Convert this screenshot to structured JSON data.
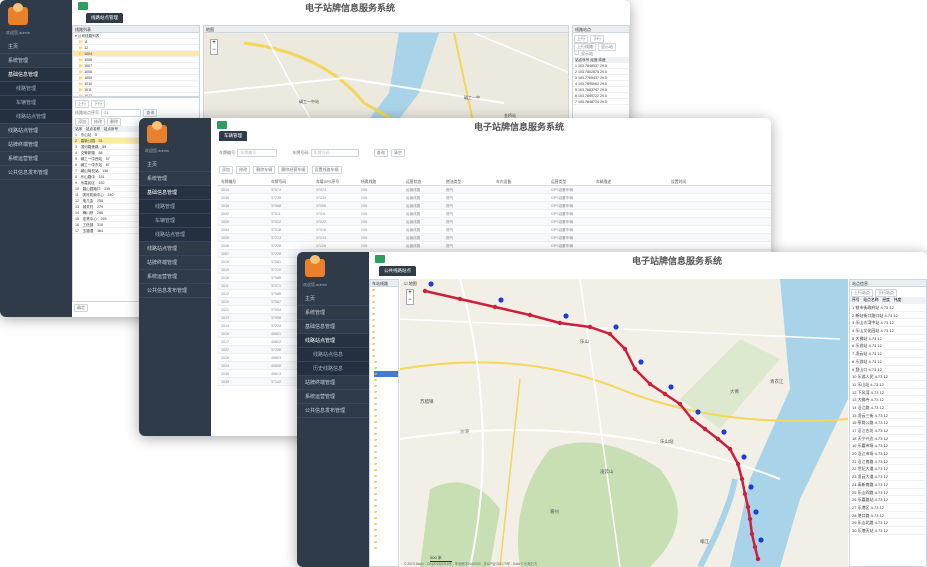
{
  "app_title": "电子站牌信息服务系统",
  "sidebar": {
    "user": "欢迎您,admin",
    "items": [
      "主页",
      "系统管理",
      "基础信息管理",
      "线路管理",
      "车辆管理",
      "线路站点管理",
      "站牌终端管理",
      "系统运营管理",
      "公共信息发布管理"
    ],
    "sub_items": [
      "线路管理",
      "车辆管理",
      "线路站点管理"
    ],
    "w3_sub_items": [
      "线路站点信息",
      "历史线路信息"
    ]
  },
  "window1": {
    "tab": "线路站点管理",
    "left_panel_title": "线路列表",
    "tree_root": "公司线路列表",
    "tree_items": [
      "11",
      "12",
      "1004",
      "1006",
      "1007",
      "1008",
      "1009",
      "1010",
      "1011",
      "1012"
    ],
    "dir_tabs": [
      "上行",
      "下行"
    ],
    "query_label": "线路站点序号:",
    "query_value": "21",
    "query_btn": "查询",
    "toolbar": [
      "添加",
      "修改",
      "删除"
    ],
    "cols": [
      "站序",
      "站点名称",
      "站点序号"
    ],
    "stops": [
      [
        "1",
        "东山站",
        "8"
      ],
      [
        "2",
        "高新公园",
        "31"
      ],
      [
        "3",
        "滨河路莲路",
        "59"
      ],
      [
        "4",
        "交警新路",
        "58"
      ],
      [
        "5",
        "碱工一中西站",
        "57"
      ],
      [
        "6",
        "碱工一中东站",
        "87"
      ],
      [
        "7",
        "碱山驾校站",
        "136"
      ],
      [
        "8",
        "乐山路中",
        "151"
      ],
      [
        "9",
        "乐嘉民区",
        "152"
      ],
      [
        "10",
        "碧山园路口",
        "235"
      ],
      [
        "11",
        "滨河苑南中心",
        "240"
      ],
      [
        "12",
        "电几会",
        "255"
      ],
      [
        "13",
        "城关村",
        "279"
      ],
      [
        "14",
        "梅川桥",
        "266"
      ],
      [
        "15",
        "定慧中心",
        "293"
      ],
      [
        "16",
        "工信部",
        "318"
      ],
      [
        "17",
        "玉福谭",
        "364"
      ]
    ],
    "map_title": "地图",
    "map_places": [
      "碱工一中站",
      "碱工一中",
      "金桥站"
    ],
    "right_title": "线路站点",
    "right_tabs": [
      "上行",
      "下行"
    ],
    "right_select": "上行线路",
    "right_btn": "显示站",
    "right_check": "显示站",
    "right_cols": [
      "站点序号",
      "经度",
      "纬度"
    ],
    "right_rows": [
      [
        "1",
        "103.7848537",
        "29.5"
      ],
      [
        "2",
        "103.7802875",
        "29.5"
      ],
      [
        "3",
        "103.7765437",
        "29.5"
      ],
      [
        "4",
        "103.7895062",
        "29.5"
      ],
      [
        "5",
        "103.7683747",
        "29.5"
      ],
      [
        "6",
        "103.7649722",
        "29.5"
      ],
      [
        "7",
        "103.7648724",
        "29.5"
      ]
    ],
    "footer": "确定"
  },
  "window2": {
    "tab": "车辆管理",
    "filter_label1": "车牌编号:",
    "filter_label2": "车牌号码:",
    "filter_ph1": "车牌编号",
    "filter_ph2": "车牌号码",
    "search_btn": "查询",
    "clear_btn": "清空",
    "toolbar": [
      "添加",
      "修改",
      "删除车辆",
      "删除经营车辆",
      "设置线路车辆"
    ],
    "cols": [
      "车牌编号",
      "车牌号码",
      "车载GPS序号",
      "所属线路",
      "运营状态",
      "燃油类型",
      "车内设备",
      "运营类型",
      "车辆描述",
      "设置时间"
    ],
    "rows": [
      [
        "3014",
        "37074",
        "37074",
        "205",
        "运营线路",
        "燃气",
        "GPS设置车辆"
      ],
      [
        "3040",
        "37239",
        "37239",
        "205",
        "运营线路",
        "燃气",
        "GPS设置车辆"
      ],
      [
        "3038",
        "37068",
        "37068",
        "205",
        "运营线路",
        "燃气",
        "GPS设置车辆"
      ],
      [
        "3092",
        "37011",
        "37011",
        "205",
        "运营线路",
        "燃气",
        "GPS设置车辆"
      ],
      [
        "3009",
        "37022",
        "37022",
        "205",
        "运营线路",
        "燃气",
        "GPS设置车辆"
      ],
      [
        "3054",
        "37018",
        "37018",
        "205",
        "运营线路",
        "燃气",
        "GPS设置车辆"
      ],
      [
        "3005",
        "37213",
        "37213",
        "205",
        "运营线路",
        "燃气",
        "GPS设置车辆"
      ],
      [
        "3058",
        "37228",
        "37228",
        "205",
        "运营线路",
        "燃气",
        "GPS设置车辆"
      ],
      [
        "3067",
        "37228",
        "37228",
        "205",
        "运营线路",
        "燃气",
        "GPS设置车辆"
      ],
      [
        "3018",
        "37081",
        "37081",
        "",
        "",
        "",
        ""
      ],
      [
        "3019",
        "37210",
        "37210",
        "",
        "",
        "",
        ""
      ],
      [
        "3016",
        "37086",
        "37086",
        "",
        "",
        "",
        ""
      ],
      [
        "3011",
        "37071",
        "37071",
        "",
        "",
        "",
        ""
      ],
      [
        "3012",
        "37086",
        "37086",
        "",
        "",
        "",
        ""
      ],
      [
        "3020",
        "37067",
        "37067",
        "",
        "",
        "",
        ""
      ],
      [
        "3021",
        "37054",
        "37054",
        "",
        "",
        "",
        ""
      ],
      [
        "3013",
        "37098",
        "37098",
        "",
        "",
        "",
        ""
      ],
      [
        "3014",
        "37224",
        "37224",
        "",
        "",
        "",
        ""
      ],
      [
        "3016",
        "49801",
        "49801",
        "",
        "",
        "",
        ""
      ],
      [
        "3017",
        "49802",
        "49802",
        "",
        "",
        "",
        ""
      ],
      [
        "3027",
        "37206",
        "37206",
        "",
        "",
        "",
        ""
      ],
      [
        "3028",
        "49803",
        "49803",
        "",
        "",
        "",
        ""
      ],
      [
        "3024",
        "49806",
        "49806",
        "",
        "",
        "",
        ""
      ],
      [
        "3030",
        "49813",
        "49813",
        "",
        "",
        "",
        ""
      ],
      [
        "3035",
        "37142",
        "37142",
        "",
        "",
        "",
        ""
      ]
    ]
  },
  "window3": {
    "tab": "公共线路站点",
    "left_title": "车站线路",
    "map_check": "地图",
    "right_title": "站点信息",
    "right_tabs": [
      "上行站点",
      "下行站点"
    ],
    "right_cols": [
      "序号",
      "站点名称",
      "经度",
      "纬度"
    ],
    "stops": [
      [
        "1",
        "铁市街政府站"
      ],
      [
        "2",
        "新站街口路口站"
      ],
      [
        "3",
        "乐山沙湾中站"
      ],
      [
        "4",
        "乐山文化园站"
      ],
      [
        "5",
        "大佛站"
      ],
      [
        "6",
        "乐游站"
      ],
      [
        "7",
        "凌云站"
      ],
      [
        "8",
        "乐游站"
      ],
      [
        "9",
        "登山口"
      ],
      [
        "10",
        "乐游人民"
      ],
      [
        "11",
        "乐山站"
      ],
      [
        "12",
        "下风湾"
      ],
      [
        "13",
        "大佛寺"
      ],
      [
        "14",
        "沿江路"
      ],
      [
        "15",
        "凌云三街"
      ],
      [
        "16",
        "亭岗公路"
      ],
      [
        "17",
        "沿江古坊"
      ],
      [
        "18",
        "天宁兴边"
      ],
      [
        "19",
        "乐嘉市场"
      ],
      [
        "20",
        "沿江市场"
      ],
      [
        "21",
        "沿江南路"
      ],
      [
        "22",
        "世纪大道"
      ],
      [
        "23",
        "凌云大道"
      ],
      [
        "24",
        "高新南路"
      ],
      [
        "25",
        "乐山四路"
      ],
      [
        "26",
        "乐嘉路站"
      ],
      [
        "27",
        "乐港区"
      ],
      [
        "28",
        "港口路"
      ],
      [
        "29",
        "乐山北路"
      ],
      [
        "30",
        "乐港天站"
      ]
    ],
    "stop_lng": "4.73",
    "stop_lat": "12",
    "map_footer": "© 2019 Baidu - GS(2019)5218号 - 甲测资字1100930 - 京ICP证030173号 - Data © 长地万方",
    "scale": "500 米",
    "map_places": [
      "乐山",
      "大佛",
      "凌云山",
      "沙湾",
      "嘉州",
      "苏稽镇",
      "乐山站",
      "青衣江",
      "岷江"
    ]
  },
  "colors": {
    "sidebar": "#2f3b48",
    "accent": "#2e9d5d",
    "route": "#cc1f3d",
    "pin": "#1d3fcf",
    "water": "#a9d3e8",
    "green": "#c8dfb4"
  }
}
